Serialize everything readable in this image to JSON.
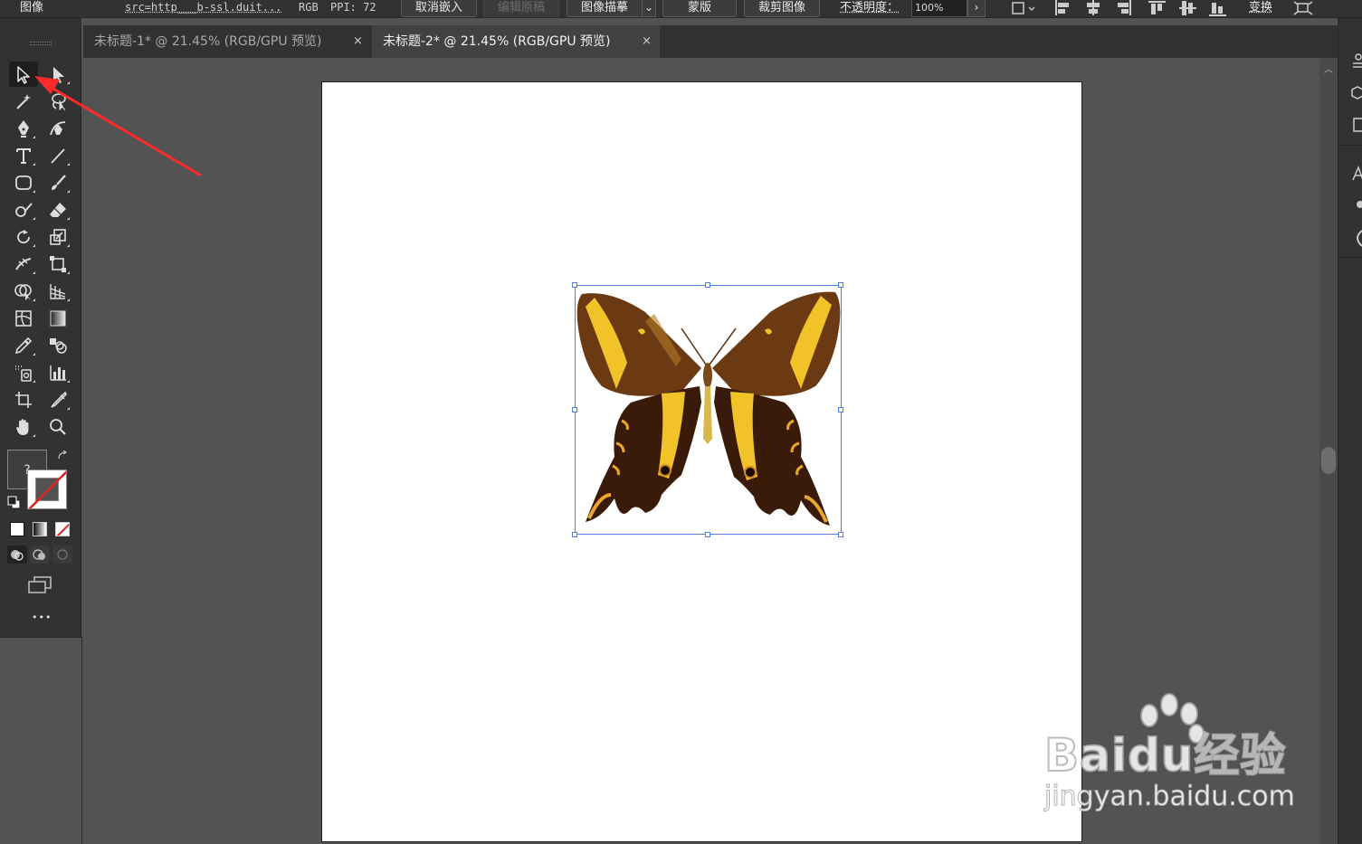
{
  "control_bar": {
    "object_type": "图像",
    "link_name": "src=http___b-ssl.duit...",
    "color_mode": "RGB",
    "ppi": "PPI: 72",
    "unembed_button": "取消嵌入",
    "edit_original_button": "编辑原稿",
    "image_trace_button": "图像描摹",
    "mask_button": "蒙版",
    "crop_button": "裁剪图像",
    "opacity_label": "不透明度：",
    "opacity_value": "100%",
    "more_chevron": "›",
    "transform_button": "变换"
  },
  "tabs": [
    {
      "title": "未标题-1* @ 21.45% (RGB/GPU 预览)",
      "active": false,
      "close": "×"
    },
    {
      "title": "未标题-2* @ 21.45% (RGB/GPU 预览)",
      "active": true,
      "close": "×"
    }
  ],
  "toolbar": {
    "collapse_glyph": "«",
    "fill_unknown": "?",
    "more_tools": "•••"
  },
  "watermark": {
    "brand": "Baidu经验",
    "site": "jingyan.baidu.com"
  },
  "colors": {
    "annotation_arrow": "#ff2a2a",
    "selection": "#4c7fd9",
    "artboard": "#ffffff",
    "workspace": "#535353"
  }
}
